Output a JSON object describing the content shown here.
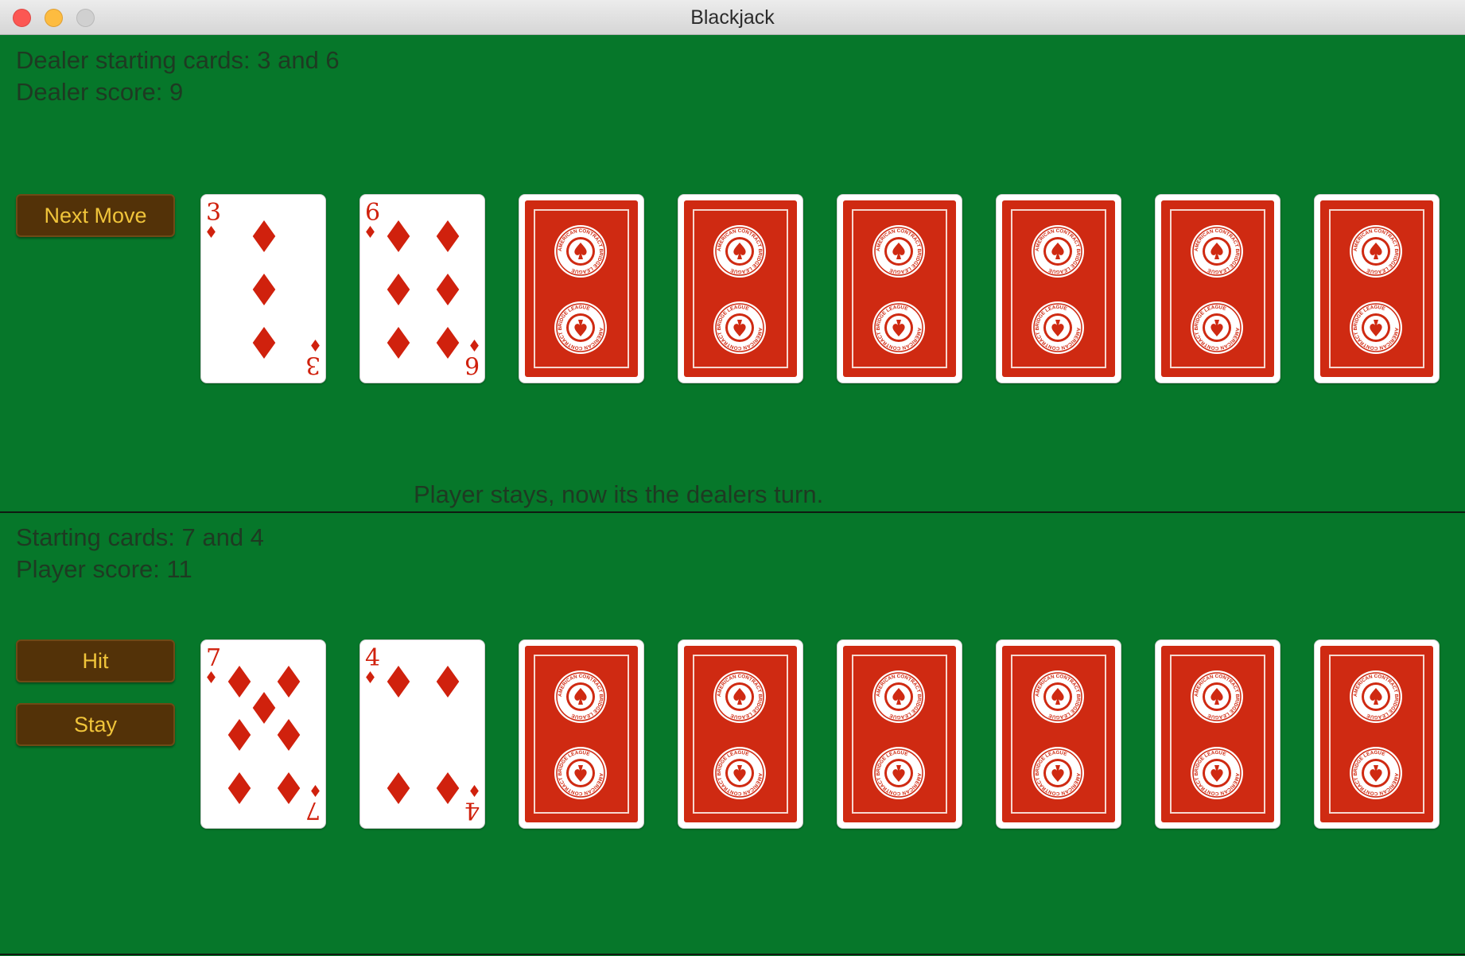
{
  "window": {
    "title": "Blackjack"
  },
  "dealer": {
    "starting_cards_text": "Dealer starting cards: 3 and 6",
    "score_text": "Dealer score: 9",
    "next_move_label": "Next Move",
    "cards": [
      {
        "rank": "3",
        "suit": "diamonds",
        "face_up": true
      },
      {
        "rank": "6",
        "suit": "diamonds",
        "face_up": true
      },
      {
        "face_up": false
      },
      {
        "face_up": false
      },
      {
        "face_up": false
      },
      {
        "face_up": false
      },
      {
        "face_up": false
      },
      {
        "face_up": false
      }
    ]
  },
  "status_message": "Player stays, now its the dealers turn.",
  "player": {
    "starting_cards_text": "Starting cards: 7 and 4",
    "score_text": "Player score: 11",
    "hit_label": "Hit",
    "stay_label": "Stay",
    "cards": [
      {
        "rank": "7",
        "suit": "diamonds",
        "face_up": true
      },
      {
        "rank": "4",
        "suit": "diamonds",
        "face_up": true
      },
      {
        "face_up": false
      },
      {
        "face_up": false
      },
      {
        "face_up": false
      },
      {
        "face_up": false
      },
      {
        "face_up": false
      },
      {
        "face_up": false
      }
    ]
  },
  "card_back_seal_text": "AMERICAN CONTRACT BRIDGE LEAGUE",
  "colors": {
    "table": "#06772a",
    "button": "#533208",
    "button_text": "#f0c43a",
    "card_red": "#d0210d",
    "card_back": "#cf2a12"
  }
}
